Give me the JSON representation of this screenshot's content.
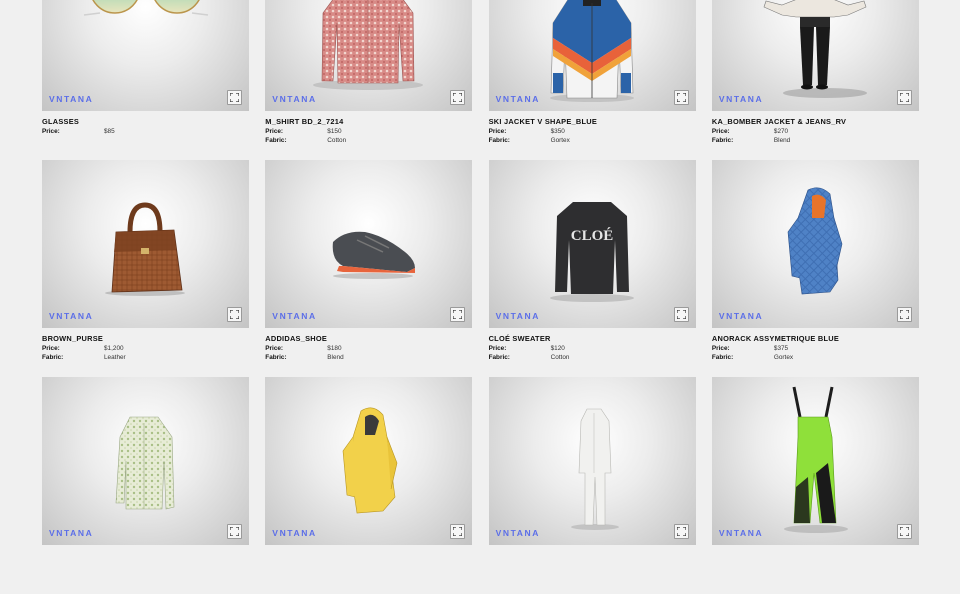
{
  "brand": "VNTANA",
  "labels": {
    "price": "Price:",
    "fabric": "Fabric:"
  },
  "products": [
    {
      "name": "GLASSES",
      "price": "$85",
      "fabric": "",
      "icon": "sunglasses-icon"
    },
    {
      "name": "M_SHIRT BD_2_7214",
      "price": "$150",
      "fabric": "Cotton",
      "icon": "shirt-icon"
    },
    {
      "name": "SKI JACKET V SHAPE_BLUE",
      "price": "$350",
      "fabric": "Gortex",
      "icon": "ski-jacket-icon"
    },
    {
      "name": "KA_BOMBER JACKET & JEANS_RV",
      "price": "$270",
      "fabric": "Blend",
      "icon": "outfit-icon"
    },
    {
      "name": "BROWN_PURSE",
      "price": "$1,200",
      "fabric": "Leather",
      "icon": "purse-icon"
    },
    {
      "name": "ADDIDAS_SHOE",
      "price": "$180",
      "fabric": "Blend",
      "icon": "shoe-icon"
    },
    {
      "name": "CLOÉ SWEATER",
      "price": "$120",
      "fabric": "Cotton",
      "icon": "sweater-icon"
    },
    {
      "name": "ANORACK ASSYMETRIQUE BLUE",
      "price": "$375",
      "fabric": "Gortex",
      "icon": "anorak-icon"
    },
    {
      "name": "",
      "price": "",
      "fabric": "",
      "icon": "floral-shirt-icon"
    },
    {
      "name": "",
      "price": "",
      "fabric": "",
      "icon": "yellow-jacket-icon"
    },
    {
      "name": "",
      "price": "",
      "fabric": "",
      "icon": "white-suit-icon"
    },
    {
      "name": "",
      "price": "",
      "fabric": "",
      "icon": "overalls-icon"
    }
  ],
  "sweater_text": "CLOÉ",
  "colors": {
    "brand": "#5b6ee8",
    "background": "#f0f0f0"
  }
}
